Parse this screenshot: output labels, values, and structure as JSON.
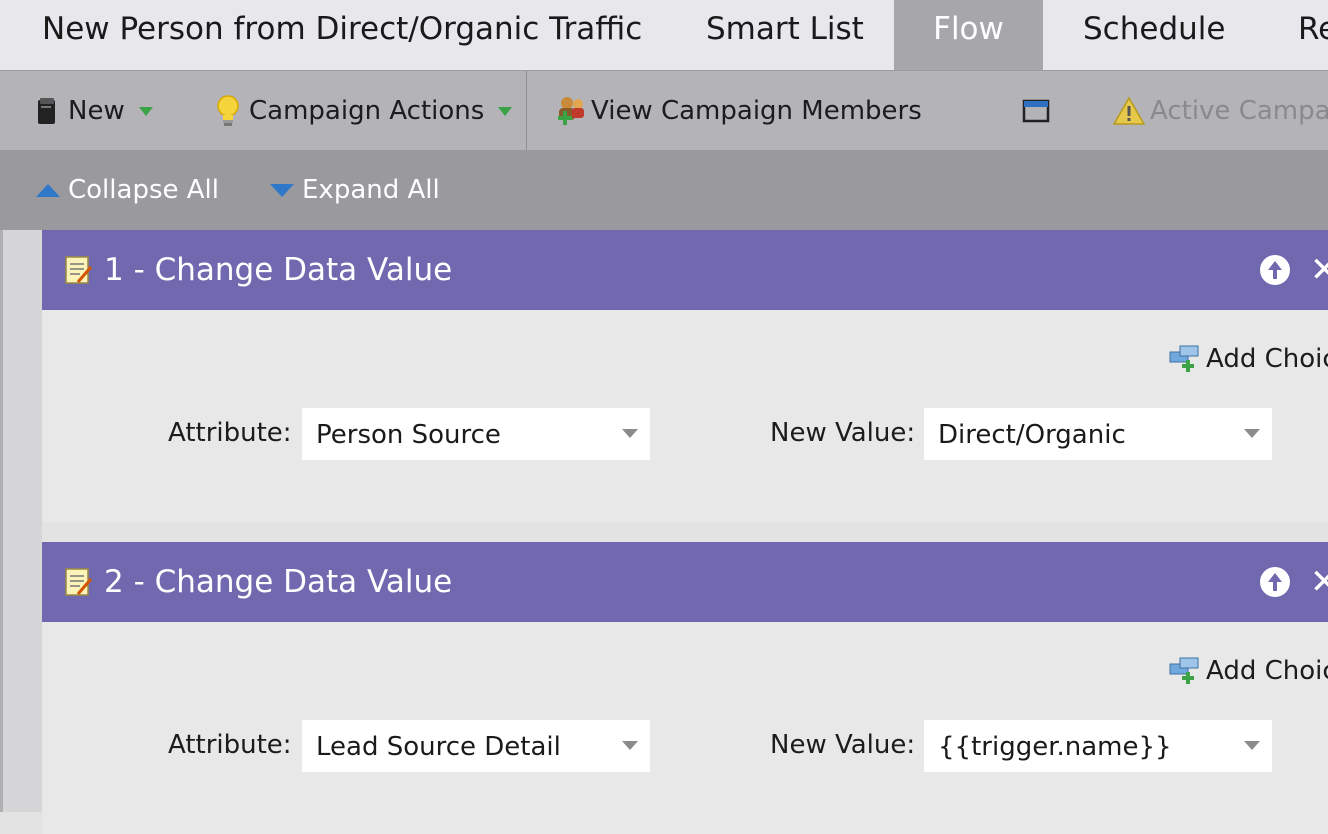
{
  "tabs": {
    "title": "New Person from Direct/Organic Traffic",
    "smart_list": "Smart List",
    "flow": "Flow",
    "schedule": "Schedule",
    "results_partial": "Re"
  },
  "toolbar": {
    "new_label": "New",
    "campaign_actions_label": "Campaign Actions",
    "view_members_label": "View Campaign Members",
    "active_label": "Active Campaig"
  },
  "subbar": {
    "collapse_label": "Collapse All",
    "expand_label": "Expand All"
  },
  "steps": [
    {
      "title": "1 - Change Data Value",
      "add_choice": "Add Choic",
      "attribute_label": "Attribute:",
      "attribute_value": "Person Source",
      "new_value_label": "New Value:",
      "new_value": "Direct/Organic"
    },
    {
      "title": "2 - Change Data Value",
      "add_choice": "Add Choic",
      "attribute_label": "Attribute:",
      "attribute_value": "Lead Source Detail",
      "new_value_label": "New Value:",
      "new_value": "{{trigger.name}}"
    }
  ],
  "colors": {
    "step_header": "#7069b0",
    "active_tab": "#a6a6ab",
    "toolbar": "#b3b3b8",
    "subbar": "#9a9a9e"
  }
}
